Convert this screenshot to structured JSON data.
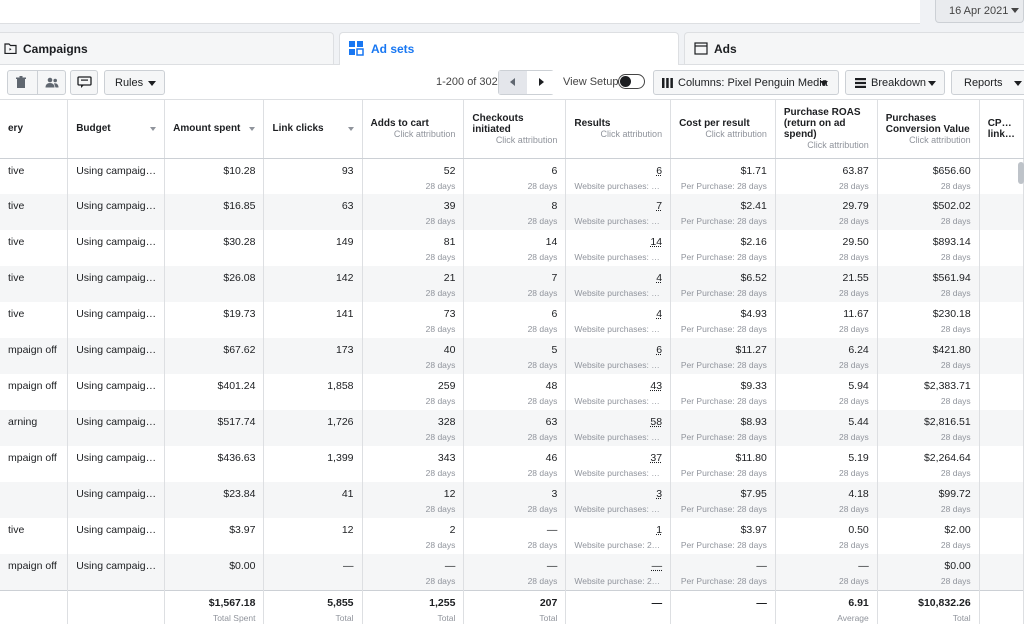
{
  "date_range": "16 Apr 2021",
  "tabs": [
    {
      "label": "Campaigns",
      "icon": "folder-icon"
    },
    {
      "label": "Ad sets",
      "icon": "grid-icon"
    },
    {
      "label": "Ads",
      "icon": "ad-page-icon"
    }
  ],
  "toolbar": {
    "rules_label": "Rules",
    "pager_text": "1-200 of 302",
    "view_setup_label": "View Setup",
    "columns_label": "Columns: Pixel Penguin Media",
    "breakdown_label": "Breakdown",
    "reports_label": "Reports"
  },
  "table": {
    "headers": {
      "delivery": "ery",
      "budget": "Budget",
      "amount_spent": "Amount spent",
      "link_clicks": "Link clicks",
      "adds_to_cart": "Adds to cart",
      "adds_to_cart_sub": "Click attribution",
      "checkouts": "Checkouts initiated",
      "checkouts_sub": "Click attribution",
      "results": "Results",
      "results_sub": "Click attribution",
      "cost_per_result": "Cost per result",
      "cost_per_result_sub": "Click attribution",
      "roas": "Purchase ROAS (return on ad spend)",
      "roas_sub": "Click attribution",
      "conv_value": "Purchases Conversion Value",
      "conv_value_sub": "Click attribution",
      "cpc": "CP… link…"
    },
    "rows": [
      {
        "delivery": "tive",
        "budget": "Using campaig…",
        "amount": "$10.28",
        "clicks": "93",
        "atc": "52",
        "atc_sub": "28 days",
        "checkouts": "6",
        "checkouts_sub": "28 days",
        "results": "6",
        "results_sub": "Website purchases: …",
        "cpr": "$1.71",
        "cpr_sub": "Per Purchase: 28 days",
        "roas": "63.87",
        "roas_sub": "28 days",
        "value": "$656.60",
        "value_sub": "28 days"
      },
      {
        "delivery": "tive",
        "budget": "Using campaig…",
        "amount": "$16.85",
        "clicks": "63",
        "atc": "39",
        "atc_sub": "28 days",
        "checkouts": "8",
        "checkouts_sub": "28 days",
        "results": "7",
        "results_sub": "Website purchases: …",
        "cpr": "$2.41",
        "cpr_sub": "Per Purchase: 28 days",
        "roas": "29.79",
        "roas_sub": "28 days",
        "value": "$502.02",
        "value_sub": "28 days"
      },
      {
        "delivery": "tive",
        "budget": "Using campaig…",
        "amount": "$30.28",
        "clicks": "149",
        "atc": "81",
        "atc_sub": "28 days",
        "checkouts": "14",
        "checkouts_sub": "28 days",
        "results": "14",
        "results_sub": "Website purchases: …",
        "cpr": "$2.16",
        "cpr_sub": "Per Purchase: 28 days",
        "roas": "29.50",
        "roas_sub": "28 days",
        "value": "$893.14",
        "value_sub": "28 days"
      },
      {
        "delivery": "tive",
        "budget": "Using campaig…",
        "amount": "$26.08",
        "clicks": "142",
        "atc": "21",
        "atc_sub": "28 days",
        "checkouts": "7",
        "checkouts_sub": "28 days",
        "results": "4",
        "results_sub": "Website purchases: …",
        "cpr": "$6.52",
        "cpr_sub": "Per Purchase: 28 days",
        "roas": "21.55",
        "roas_sub": "28 days",
        "value": "$561.94",
        "value_sub": "28 days"
      },
      {
        "delivery": "tive",
        "budget": "Using campaig…",
        "amount": "$19.73",
        "clicks": "141",
        "atc": "73",
        "atc_sub": "28 days",
        "checkouts": "6",
        "checkouts_sub": "28 days",
        "results": "4",
        "results_sub": "Website purchases: …",
        "cpr": "$4.93",
        "cpr_sub": "Per Purchase: 28 days",
        "roas": "11.67",
        "roas_sub": "28 days",
        "value": "$230.18",
        "value_sub": "28 days"
      },
      {
        "delivery": "mpaign off",
        "budget": "Using campaig…",
        "amount": "$67.62",
        "clicks": "173",
        "atc": "40",
        "atc_sub": "28 days",
        "checkouts": "5",
        "checkouts_sub": "28 days",
        "results": "6",
        "results_sub": "Website purchases: …",
        "cpr": "$11.27",
        "cpr_sub": "Per Purchase: 28 days",
        "roas": "6.24",
        "roas_sub": "28 days",
        "value": "$421.80",
        "value_sub": "28 days"
      },
      {
        "delivery": "mpaign off",
        "budget": "Using campaig…",
        "amount": "$401.24",
        "clicks": "1,858",
        "atc": "259",
        "atc_sub": "28 days",
        "checkouts": "48",
        "checkouts_sub": "28 days",
        "results": "43",
        "results_sub": "Website purchases: …",
        "cpr": "$9.33",
        "cpr_sub": "Per Purchase: 28 days",
        "roas": "5.94",
        "roas_sub": "28 days",
        "value": "$2,383.71",
        "value_sub": "28 days"
      },
      {
        "delivery": "arning",
        "budget": "Using campaig…",
        "amount": "$517.74",
        "clicks": "1,726",
        "atc": "328",
        "atc_sub": "28 days",
        "checkouts": "63",
        "checkouts_sub": "28 days",
        "results": "58",
        "results_sub": "Website purchases: …",
        "cpr": "$8.93",
        "cpr_sub": "Per Purchase: 28 days",
        "roas": "5.44",
        "roas_sub": "28 days",
        "value": "$2,816.51",
        "value_sub": "28 days"
      },
      {
        "delivery": "mpaign off",
        "budget": "Using campaig…",
        "amount": "$436.63",
        "clicks": "1,399",
        "atc": "343",
        "atc_sub": "28 days",
        "checkouts": "46",
        "checkouts_sub": "28 days",
        "results": "37",
        "results_sub": "Website purchases: …",
        "cpr": "$11.80",
        "cpr_sub": "Per Purchase: 28 days",
        "roas": "5.19",
        "roas_sub": "28 days",
        "value": "$2,264.64",
        "value_sub": "28 days"
      },
      {
        "delivery": "",
        "budget": "Using campaig…",
        "amount": "$23.84",
        "clicks": "41",
        "atc": "12",
        "atc_sub": "28 days",
        "checkouts": "3",
        "checkouts_sub": "28 days",
        "results": "3",
        "results_sub": "Website purchases: …",
        "cpr": "$7.95",
        "cpr_sub": "Per Purchase: 28 days",
        "roas": "4.18",
        "roas_sub": "28 days",
        "value": "$99.72",
        "value_sub": "28 days"
      },
      {
        "delivery": "tive",
        "budget": "Using campaig…",
        "amount": "$3.97",
        "clicks": "12",
        "atc": "2",
        "atc_sub": "28 days",
        "checkouts": "—",
        "checkouts_sub": "28 days",
        "results": "1",
        "results_sub": "Website purchase: 2…",
        "cpr": "$3.97",
        "cpr_sub": "Per Purchase: 28 days",
        "roas": "0.50",
        "roas_sub": "28 days",
        "value": "$2.00",
        "value_sub": "28 days"
      },
      {
        "delivery": "mpaign off",
        "budget": "Using campaig…",
        "amount": "$0.00",
        "clicks": "—",
        "atc": "—",
        "atc_sub": "28 days",
        "checkouts": "—",
        "checkouts_sub": "28 days",
        "results": "—",
        "results_sub": "Website purchase: 2…",
        "cpr": "—",
        "cpr_sub": "Per Purchase: 28 days",
        "roas": "—",
        "roas_sub": "28 days",
        "value": "$0.00",
        "value_sub": "28 days"
      }
    ],
    "totals": {
      "amount": "$1,567.18",
      "amount_sub": "Total Spent",
      "clicks": "5,855",
      "clicks_sub": "Total",
      "atc": "1,255",
      "atc_sub": "Total",
      "checkouts": "207",
      "checkouts_sub": "Total",
      "results": "—",
      "cpr": "—",
      "roas": "6.91",
      "roas_sub": "Average",
      "value": "$10,832.26",
      "value_sub": "Total"
    }
  }
}
